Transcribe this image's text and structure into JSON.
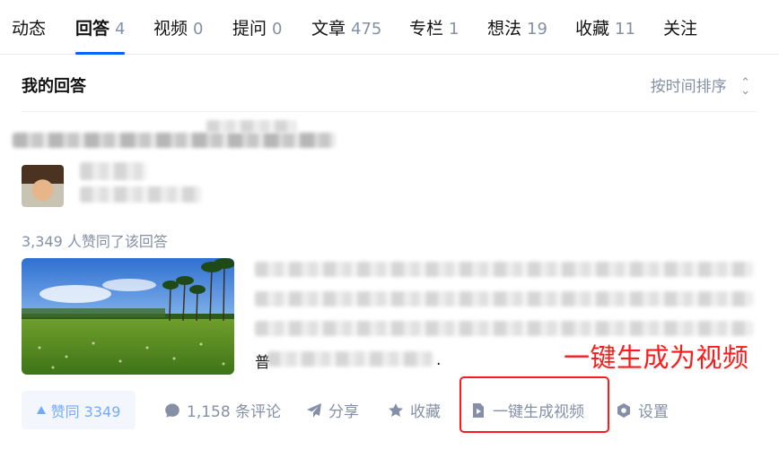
{
  "tabs": [
    {
      "label": "动态",
      "count": ""
    },
    {
      "label": "回答",
      "count": "4"
    },
    {
      "label": "视频",
      "count": "0"
    },
    {
      "label": "提问",
      "count": "0"
    },
    {
      "label": "文章",
      "count": "475"
    },
    {
      "label": "专栏",
      "count": "1"
    },
    {
      "label": "想法",
      "count": "19"
    },
    {
      "label": "收藏",
      "count": "11"
    },
    {
      "label": "关注",
      "count": ""
    }
  ],
  "active_tab": "回答",
  "section": {
    "title": "我的回答",
    "sort_label": "按时间排序"
  },
  "answer": {
    "upvote_summary": "3,349 人赞同了该回答",
    "content_tail_char": "普",
    "content_end": "."
  },
  "annotation": {
    "label": "一键生成为视频",
    "color": "#ff1a1a"
  },
  "actions": {
    "vote": "赞同 3349",
    "comments": "1,158 条评论",
    "share": "分享",
    "favorite": "收藏",
    "make_video": "一键生成视频",
    "settings": "设置"
  },
  "colors": {
    "accent": "#0066ff",
    "muted": "#8590a6",
    "text": "#121212"
  }
}
